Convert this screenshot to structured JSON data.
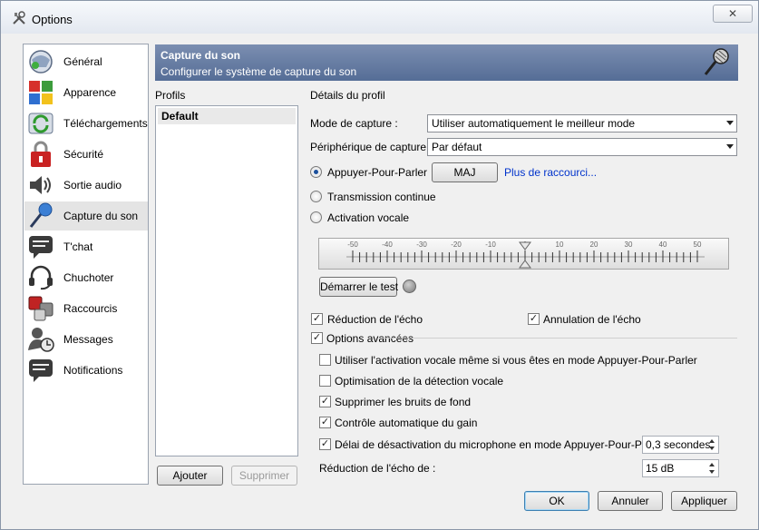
{
  "window": {
    "title": "Options",
    "close_label": "✕"
  },
  "sidebar": {
    "items": [
      {
        "label": "Général",
        "icon": "general-icon"
      },
      {
        "label": "Apparence",
        "icon": "appearance-icon"
      },
      {
        "label": "Téléchargements",
        "icon": "downloads-icon"
      },
      {
        "label": "Sécurité",
        "icon": "security-lock-icon"
      },
      {
        "label": "Sortie audio",
        "icon": "speaker-icon"
      },
      {
        "label": "Capture du son",
        "icon": "microphone-icon"
      },
      {
        "label": "T'chat",
        "icon": "chat-icon"
      },
      {
        "label": "Chuchoter",
        "icon": "headset-icon"
      },
      {
        "label": "Raccourcis",
        "icon": "hotkeys-icon"
      },
      {
        "label": "Messages",
        "icon": "messages-icon"
      },
      {
        "label": "Notifications",
        "icon": "notifications-icon"
      }
    ],
    "active": "Capture du son"
  },
  "banner": {
    "title": "Capture du son",
    "subtitle": "Configurer le système de capture du son"
  },
  "profiles": {
    "label": "Profils",
    "items": [
      "Default"
    ],
    "add_label": "Ajouter",
    "remove_label": "Supprimer"
  },
  "details": {
    "label": "Détails du profil",
    "capture_mode_label": "Mode de capture  :",
    "capture_mode_value": "Utiliser automatiquement le meilleur mode",
    "device_label": "Périphérique de capture :",
    "device_value": "Par défaut",
    "ptt_label": "Appuyer-Pour-Parler",
    "ptt_key": "MAJ",
    "more_shortcuts": "Plus de raccourci...",
    "continuous_label": "Transmission continue",
    "voice_activation_label": "Activation vocale",
    "meter_ticks": [
      "-50",
      "-40",
      "-30",
      "-20",
      "-10",
      "0",
      "10",
      "20",
      "30",
      "40",
      "50"
    ],
    "test_button": "Démarrer le test",
    "echo_reduction_label": "Réduction de l'écho",
    "echo_cancel_label": "Annulation de l'écho",
    "advanced_label": "Options avancées",
    "adv_vad_ptt": "Utiliser l'activation vocale même si vous êtes en mode Appuyer-Pour-Parler",
    "adv_vad_opt": "Optimisation de la détection vocale",
    "adv_denoise": "Supprimer les bruits de fond",
    "adv_agc": "Contrôle automatique du gain",
    "adv_delay": "Délai de désactivation du microphone en mode Appuyer-Pour-Parler:",
    "delay_value": "0,3 secondes",
    "echo_amount_label": "Réduction de l'écho de :",
    "echo_amount_value": "15 dB"
  },
  "footer": {
    "ok": "OK",
    "cancel": "Annuler",
    "apply": "Appliquer"
  }
}
